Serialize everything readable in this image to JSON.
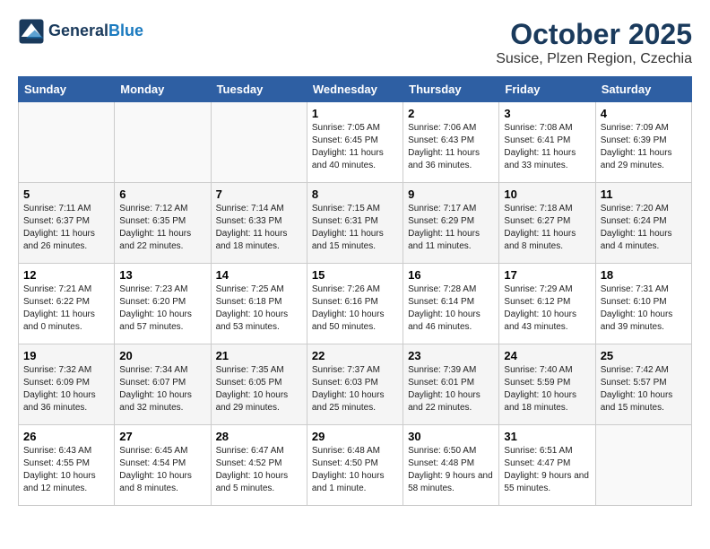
{
  "header": {
    "logo_line1": "General",
    "logo_line2": "Blue",
    "month_title": "October 2025",
    "location": "Susice, Plzen Region, Czechia"
  },
  "weekdays": [
    "Sunday",
    "Monday",
    "Tuesday",
    "Wednesday",
    "Thursday",
    "Friday",
    "Saturday"
  ],
  "weeks": [
    [
      {
        "day": "",
        "sunrise": "",
        "sunset": "",
        "daylight": ""
      },
      {
        "day": "",
        "sunrise": "",
        "sunset": "",
        "daylight": ""
      },
      {
        "day": "",
        "sunrise": "",
        "sunset": "",
        "daylight": ""
      },
      {
        "day": "1",
        "sunrise": "Sunrise: 7:05 AM",
        "sunset": "Sunset: 6:45 PM",
        "daylight": "Daylight: 11 hours and 40 minutes."
      },
      {
        "day": "2",
        "sunrise": "Sunrise: 7:06 AM",
        "sunset": "Sunset: 6:43 PM",
        "daylight": "Daylight: 11 hours and 36 minutes."
      },
      {
        "day": "3",
        "sunrise": "Sunrise: 7:08 AM",
        "sunset": "Sunset: 6:41 PM",
        "daylight": "Daylight: 11 hours and 33 minutes."
      },
      {
        "day": "4",
        "sunrise": "Sunrise: 7:09 AM",
        "sunset": "Sunset: 6:39 PM",
        "daylight": "Daylight: 11 hours and 29 minutes."
      }
    ],
    [
      {
        "day": "5",
        "sunrise": "Sunrise: 7:11 AM",
        "sunset": "Sunset: 6:37 PM",
        "daylight": "Daylight: 11 hours and 26 minutes."
      },
      {
        "day": "6",
        "sunrise": "Sunrise: 7:12 AM",
        "sunset": "Sunset: 6:35 PM",
        "daylight": "Daylight: 11 hours and 22 minutes."
      },
      {
        "day": "7",
        "sunrise": "Sunrise: 7:14 AM",
        "sunset": "Sunset: 6:33 PM",
        "daylight": "Daylight: 11 hours and 18 minutes."
      },
      {
        "day": "8",
        "sunrise": "Sunrise: 7:15 AM",
        "sunset": "Sunset: 6:31 PM",
        "daylight": "Daylight: 11 hours and 15 minutes."
      },
      {
        "day": "9",
        "sunrise": "Sunrise: 7:17 AM",
        "sunset": "Sunset: 6:29 PM",
        "daylight": "Daylight: 11 hours and 11 minutes."
      },
      {
        "day": "10",
        "sunrise": "Sunrise: 7:18 AM",
        "sunset": "Sunset: 6:27 PM",
        "daylight": "Daylight: 11 hours and 8 minutes."
      },
      {
        "day": "11",
        "sunrise": "Sunrise: 7:20 AM",
        "sunset": "Sunset: 6:24 PM",
        "daylight": "Daylight: 11 hours and 4 minutes."
      }
    ],
    [
      {
        "day": "12",
        "sunrise": "Sunrise: 7:21 AM",
        "sunset": "Sunset: 6:22 PM",
        "daylight": "Daylight: 11 hours and 0 minutes."
      },
      {
        "day": "13",
        "sunrise": "Sunrise: 7:23 AM",
        "sunset": "Sunset: 6:20 PM",
        "daylight": "Daylight: 10 hours and 57 minutes."
      },
      {
        "day": "14",
        "sunrise": "Sunrise: 7:25 AM",
        "sunset": "Sunset: 6:18 PM",
        "daylight": "Daylight: 10 hours and 53 minutes."
      },
      {
        "day": "15",
        "sunrise": "Sunrise: 7:26 AM",
        "sunset": "Sunset: 6:16 PM",
        "daylight": "Daylight: 10 hours and 50 minutes."
      },
      {
        "day": "16",
        "sunrise": "Sunrise: 7:28 AM",
        "sunset": "Sunset: 6:14 PM",
        "daylight": "Daylight: 10 hours and 46 minutes."
      },
      {
        "day": "17",
        "sunrise": "Sunrise: 7:29 AM",
        "sunset": "Sunset: 6:12 PM",
        "daylight": "Daylight: 10 hours and 43 minutes."
      },
      {
        "day": "18",
        "sunrise": "Sunrise: 7:31 AM",
        "sunset": "Sunset: 6:10 PM",
        "daylight": "Daylight: 10 hours and 39 minutes."
      }
    ],
    [
      {
        "day": "19",
        "sunrise": "Sunrise: 7:32 AM",
        "sunset": "Sunset: 6:09 PM",
        "daylight": "Daylight: 10 hours and 36 minutes."
      },
      {
        "day": "20",
        "sunrise": "Sunrise: 7:34 AM",
        "sunset": "Sunset: 6:07 PM",
        "daylight": "Daylight: 10 hours and 32 minutes."
      },
      {
        "day": "21",
        "sunrise": "Sunrise: 7:35 AM",
        "sunset": "Sunset: 6:05 PM",
        "daylight": "Daylight: 10 hours and 29 minutes."
      },
      {
        "day": "22",
        "sunrise": "Sunrise: 7:37 AM",
        "sunset": "Sunset: 6:03 PM",
        "daylight": "Daylight: 10 hours and 25 minutes."
      },
      {
        "day": "23",
        "sunrise": "Sunrise: 7:39 AM",
        "sunset": "Sunset: 6:01 PM",
        "daylight": "Daylight: 10 hours and 22 minutes."
      },
      {
        "day": "24",
        "sunrise": "Sunrise: 7:40 AM",
        "sunset": "Sunset: 5:59 PM",
        "daylight": "Daylight: 10 hours and 18 minutes."
      },
      {
        "day": "25",
        "sunrise": "Sunrise: 7:42 AM",
        "sunset": "Sunset: 5:57 PM",
        "daylight": "Daylight: 10 hours and 15 minutes."
      }
    ],
    [
      {
        "day": "26",
        "sunrise": "Sunrise: 6:43 AM",
        "sunset": "Sunset: 4:55 PM",
        "daylight": "Daylight: 10 hours and 12 minutes."
      },
      {
        "day": "27",
        "sunrise": "Sunrise: 6:45 AM",
        "sunset": "Sunset: 4:54 PM",
        "daylight": "Daylight: 10 hours and 8 minutes."
      },
      {
        "day": "28",
        "sunrise": "Sunrise: 6:47 AM",
        "sunset": "Sunset: 4:52 PM",
        "daylight": "Daylight: 10 hours and 5 minutes."
      },
      {
        "day": "29",
        "sunrise": "Sunrise: 6:48 AM",
        "sunset": "Sunset: 4:50 PM",
        "daylight": "Daylight: 10 hours and 1 minute."
      },
      {
        "day": "30",
        "sunrise": "Sunrise: 6:50 AM",
        "sunset": "Sunset: 4:48 PM",
        "daylight": "Daylight: 9 hours and 58 minutes."
      },
      {
        "day": "31",
        "sunrise": "Sunrise: 6:51 AM",
        "sunset": "Sunset: 4:47 PM",
        "daylight": "Daylight: 9 hours and 55 minutes."
      },
      {
        "day": "",
        "sunrise": "",
        "sunset": "",
        "daylight": ""
      }
    ]
  ]
}
